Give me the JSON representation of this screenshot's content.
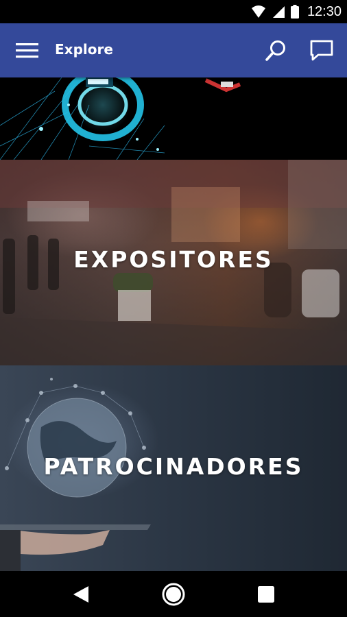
{
  "status_bar": {
    "time": "12:30",
    "icons": [
      "wifi-icon",
      "signal-icon",
      "battery-icon"
    ]
  },
  "app_bar": {
    "title": "Explore",
    "background_color": "#34499a",
    "actions": [
      "menu-icon",
      "search-icon",
      "chat-icon"
    ]
  },
  "tiles": [
    {
      "label": "",
      "image": "technology-network-image"
    },
    {
      "label": "EXPOSITORES",
      "image": "exhibition-hall-image"
    },
    {
      "label": "PATROCINADORES",
      "image": "globe-tablet-image"
    }
  ],
  "nav_bar": {
    "buttons": [
      "back-icon",
      "home-icon",
      "recents-icon"
    ]
  }
}
